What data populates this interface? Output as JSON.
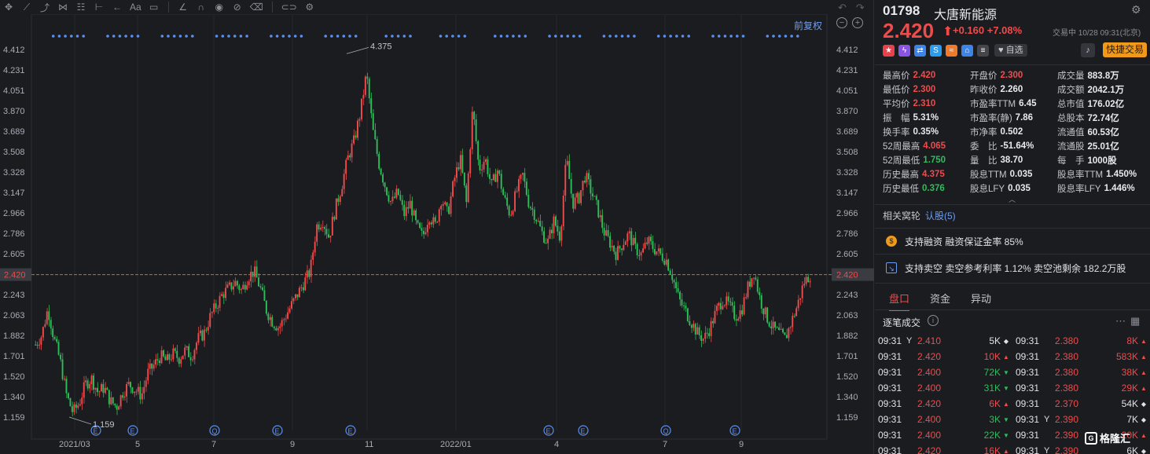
{
  "toolbar": {
    "icons": [
      "crosshair-icon",
      "line-draw-icon",
      "trend-tool-icon",
      "pattern-icon",
      "fib-icon",
      "measure-icon",
      "arrow-icon",
      "text-icon",
      "comment-icon",
      "ruler-icon",
      "magnet-icon",
      "eye-icon",
      "hide-icon",
      "trash-icon",
      "layers-icon",
      "settings-icon"
    ],
    "text_tool": "Aa"
  },
  "chart": {
    "fuquan_label": "前复权",
    "current_price_label": "2.420",
    "high_label": "4.375",
    "low_label": "1.159",
    "y_ticks": [
      "4.412",
      "4.231",
      "4.051",
      "3.870",
      "3.689",
      "3.508",
      "3.328",
      "3.147",
      "2.966",
      "2.786",
      "2.605",
      "2.424",
      "2.243",
      "2.063",
      "1.882",
      "1.701",
      "1.520",
      "1.340",
      "1.159"
    ],
    "x_labels": [
      "2021/03",
      "5",
      "7",
      "9",
      "11",
      "2022/01",
      "4",
      "7",
      "9"
    ],
    "event_markers": [
      "E",
      "E",
      "Q",
      "E",
      "E",
      "E",
      "E",
      "Q",
      "E"
    ],
    "colors": {
      "up": "#ee4b4b",
      "down": "#2fbd5a",
      "dots": "#5b8ff0",
      "price_line": "#d2691e"
    }
  },
  "chart_data": {
    "type": "candlestick",
    "title": "",
    "ylim": [
      1.159,
      4.412
    ],
    "current_price": 2.42,
    "high": 4.375,
    "low": 1.159,
    "x_labels": [
      "2021/03",
      "5",
      "7",
      "9",
      "11",
      "2022/01",
      "4",
      "7",
      "9"
    ],
    "close_path": [
      1.8,
      1.88,
      2.12,
      1.85,
      1.65,
      1.35,
      1.2,
      1.28,
      1.45,
      1.5,
      1.38,
      1.42,
      1.3,
      1.25,
      1.38,
      1.45,
      1.4,
      1.35,
      1.55,
      1.62,
      1.7,
      1.65,
      1.72,
      1.68,
      1.75,
      1.7,
      1.85,
      1.9,
      2.05,
      2.15,
      2.25,
      2.3,
      2.35,
      2.28,
      2.4,
      2.45,
      2.3,
      2.1,
      2.0,
      1.95,
      2.05,
      2.15,
      2.25,
      2.35,
      2.45,
      2.85,
      2.9,
      2.75,
      3.0,
      3.2,
      3.45,
      3.6,
      3.85,
      4.2,
      3.7,
      3.4,
      3.2,
      3.05,
      3.15,
      2.95,
      3.05,
      2.85,
      2.75,
      2.95,
      2.85,
      3.1,
      2.95,
      3.25,
      3.45,
      3.05,
      3.9,
      3.35,
      3.45,
      3.2,
      3.35,
      3.1,
      2.95,
      3.15,
      3.3,
      3.05,
      2.95,
      2.8,
      2.7,
      2.9,
      2.75,
      3.45,
      3.05,
      3.1,
      3.3,
      3.15,
      3.0,
      2.8,
      2.7,
      2.6,
      2.7,
      2.78,
      2.65,
      2.6,
      2.72,
      2.65,
      2.6,
      2.55,
      2.4,
      2.2,
      2.1,
      2.0,
      1.9,
      1.85,
      1.95,
      2.1,
      2.2,
      2.15,
      2.05,
      2.1,
      2.3,
      2.45,
      2.2,
      2.05,
      1.95,
      1.9,
      1.85,
      2.0,
      2.15,
      2.35,
      2.42
    ]
  },
  "side": {
    "code": "01798",
    "name": "大唐新能源",
    "price": "2.420",
    "arrow": "⬆",
    "change": "+0.160 +7.08%",
    "trade_state": "交易中 10/28 09:31(北京)",
    "zixuan": "自选",
    "fast_trade": "快捷交易",
    "stats": [
      [
        [
          "最高价",
          "2.420",
          "red"
        ],
        [
          "开盘价",
          "2.300",
          "red"
        ],
        [
          "成交量",
          "883.8万",
          ""
        ]
      ],
      [
        [
          "最低价",
          "2.300",
          "red"
        ],
        [
          "昨收价",
          "2.260",
          ""
        ],
        [
          "成交额",
          "2042.1万",
          ""
        ]
      ],
      [
        [
          "平均价",
          "2.310",
          "red"
        ],
        [
          "市盈率TTM",
          "6.45",
          ""
        ],
        [
          "总市值",
          "176.02亿",
          ""
        ]
      ],
      [
        [
          "振　幅",
          "5.31%",
          ""
        ],
        [
          "市盈率(静)",
          "7.86",
          ""
        ],
        [
          "总股本",
          "72.74亿",
          ""
        ]
      ],
      [
        [
          "换手率",
          "0.35%",
          ""
        ],
        [
          "市净率",
          "0.502",
          ""
        ],
        [
          "流通值",
          "60.53亿",
          ""
        ]
      ],
      [
        [
          "52周最高",
          "4.065",
          "red"
        ],
        [
          "委　比",
          "-51.64%",
          ""
        ],
        [
          "流通股",
          "25.01亿",
          ""
        ]
      ],
      [
        [
          "52周最低",
          "1.750",
          "green"
        ],
        [
          "量　比",
          "38.70",
          ""
        ],
        [
          "每　手",
          "1000股",
          ""
        ]
      ],
      [
        [
          "历史最高",
          "4.375",
          "red"
        ],
        [
          "股息TTM",
          "0.035",
          ""
        ],
        [
          "股息率TTM",
          "1.450%",
          ""
        ]
      ],
      [
        [
          "历史最低",
          "0.376",
          "green"
        ],
        [
          "股息LFY",
          "0.035",
          ""
        ],
        [
          "股息率LFY",
          "1.446%",
          ""
        ]
      ]
    ],
    "related_label": "相关窝轮",
    "related_link": "认股(5)",
    "margin_text": "支持融资 融资保证金率 85%",
    "short_text": "支持卖空 卖空参考利率 1.12% 卖空池剩余 182.2万股",
    "tabs": [
      "盘口",
      "资金",
      "异动"
    ],
    "tick_title": "逐笔成交",
    "ticks": [
      [
        [
          "09:31",
          "Y",
          "2.410",
          "red",
          "5K",
          "white",
          "◆"
        ],
        [
          "09:31",
          "",
          "2.380",
          "red",
          "8K",
          "red",
          "▲"
        ]
      ],
      [
        [
          "09:31",
          "",
          "2.420",
          "red",
          "10K",
          "red",
          "▲"
        ],
        [
          "09:31",
          "",
          "2.380",
          "red",
          "583K",
          "red",
          "▲"
        ]
      ],
      [
        [
          "09:31",
          "",
          "2.400",
          "red",
          "72K",
          "green",
          "▼"
        ],
        [
          "09:31",
          "",
          "2.380",
          "red",
          "38K",
          "red",
          "▲"
        ]
      ],
      [
        [
          "09:31",
          "",
          "2.400",
          "red",
          "31K",
          "green",
          "▼"
        ],
        [
          "09:31",
          "",
          "2.380",
          "red",
          "29K",
          "red",
          "▲"
        ]
      ],
      [
        [
          "09:31",
          "",
          "2.420",
          "red",
          "6K",
          "red",
          "▲"
        ],
        [
          "09:31",
          "",
          "2.370",
          "red",
          "54K",
          "white",
          "◆"
        ]
      ],
      [
        [
          "09:31",
          "",
          "2.400",
          "red",
          "3K",
          "green",
          "▼"
        ],
        [
          "09:31",
          "Y",
          "2.390",
          "red",
          "7K",
          "white",
          "◆"
        ]
      ],
      [
        [
          "09:31",
          "",
          "2.400",
          "red",
          "22K",
          "green",
          "▼"
        ],
        [
          "09:31",
          "",
          "2.390",
          "red",
          "20K",
          "red",
          "▲"
        ]
      ],
      [
        [
          "09:31",
          "",
          "2.420",
          "red",
          "16K",
          "red",
          "▲"
        ],
        [
          "09:31",
          "Y",
          "2.390",
          "red",
          "6K",
          "white",
          "◆"
        ]
      ]
    ],
    "watermark": "格隆汇"
  }
}
